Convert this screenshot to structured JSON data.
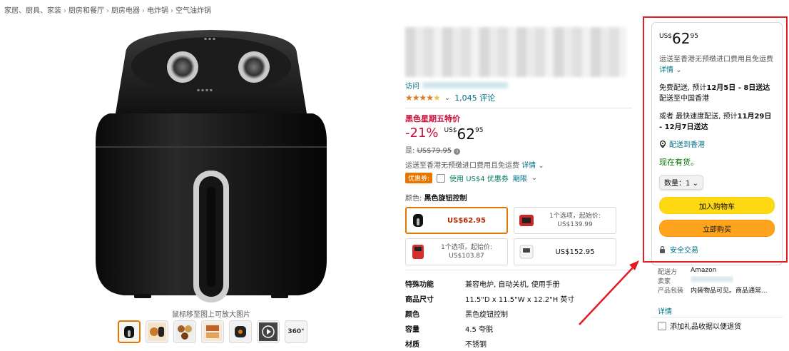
{
  "breadcrumb": [
    "家居、厨具、家装",
    "厨房和餐厅",
    "厨房电器",
    "电炸锅",
    "空气油炸锅"
  ],
  "breadcrumb_sep": "›",
  "gallery": {
    "zoom_hint": "鼠标移至图上可放大图片",
    "thumbnail_count": 7,
    "thumb_360_label": "360°"
  },
  "product": {
    "store_prefix": "访问",
    "rating_stars": 4.5,
    "rating_chevron": "⌄",
    "review_count": "1,045 评论",
    "deal_label": "黑色星期五特价",
    "discount": "-21%",
    "price_currency": "US$",
    "price_whole": "62",
    "price_fraction": "95",
    "list_price_label": "是:",
    "list_price": "US$79.95",
    "shipping_text": "运送至香港无预缴进口费用且免运费",
    "details_link": "详情",
    "coupon_badge": "优惠券:",
    "coupon_text": "使用 US$4 优惠券",
    "coupon_terms": "期限",
    "color_label": "颜色:",
    "color_value": "黑色旋钮控制",
    "variants": [
      {
        "type": "price",
        "price": "US$62.95",
        "selected": true,
        "color": "#222222"
      },
      {
        "type": "options",
        "line1": "1个选项，起始价:",
        "line2": "US$139.99",
        "selected": false,
        "color": "#c62828"
      },
      {
        "type": "options",
        "line1": "1个选项，起始价:",
        "line2": "US$103.87",
        "selected": false,
        "color": "#d32f2f"
      },
      {
        "type": "price",
        "price": "US$152.95",
        "selected": false,
        "color": "#f5f5f5"
      }
    ],
    "specs": [
      {
        "key": "特殊功能",
        "value": "兼容电炉, 自动关机, 使用手册"
      },
      {
        "key": "商品尺寸",
        "value": "11.5\"D x 11.5\"W x 12.2\"H 英寸"
      },
      {
        "key": "颜色",
        "value": "黑色旋钮控制"
      },
      {
        "key": "容量",
        "value": "4.5 夸脱"
      },
      {
        "key": "材质",
        "value": "不锈钢"
      }
    ]
  },
  "buybox": {
    "price_currency": "US$",
    "price_whole": "62",
    "price_fraction": "95",
    "shipping_text": "运送至香港无预缴进口费用且免运费",
    "details_link": "详情",
    "delivery_prefix": "免费配送, 预计",
    "delivery_date": "12月5日 - 8日送达",
    "delivery_suffix": "配送至中国香港",
    "fastest_prefix": "或者 最快速度配送, 预计",
    "fastest_date": "11月29日 - 12月7日送达",
    "location_link": "配送到香港",
    "stock": "现在有货。",
    "qty_label": "数量：",
    "qty_value": "1",
    "add_to_cart": "加入购物车",
    "buy_now": "立即购买",
    "secure": "安全交易"
  },
  "seller_info": [
    {
      "key": "配送方",
      "value": "Amazon"
    },
    {
      "key": "卖家",
      "value": ""
    },
    {
      "key": "产品包装",
      "value": "内装物品可见。商品通常..."
    }
  ],
  "details_link": "详情",
  "gift_label": "添加礼品收据以便退货",
  "colors": {
    "accent_orange": "#e77600",
    "highlight_red": "#e31b23",
    "price_red": "#cc0c39",
    "link": "#007185",
    "cart_yellow": "#ffd814",
    "buy_orange": "#ffa41c",
    "stock_green": "#007600"
  }
}
